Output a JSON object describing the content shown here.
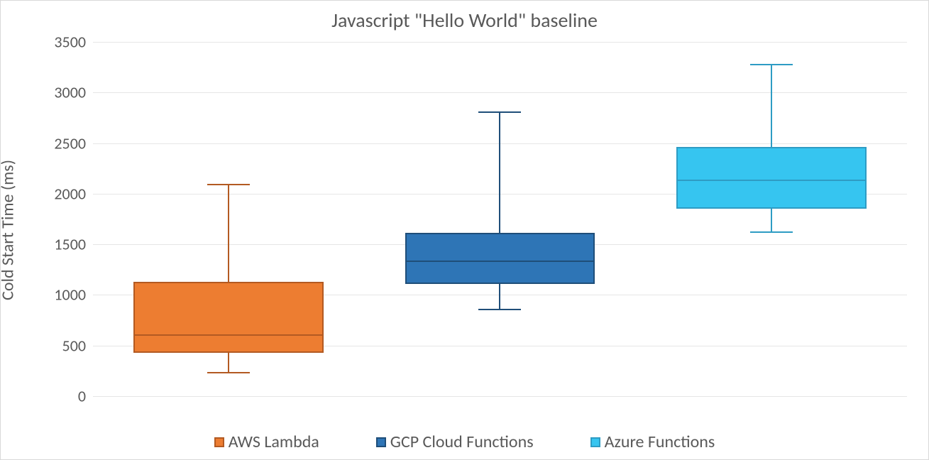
{
  "chart_data": {
    "type": "boxplot",
    "title": "Javascript \"Hello World\" baseline",
    "ylabel": "Cold Start Time (ms)",
    "xlabel": "",
    "ylim": [
      0,
      3500
    ],
    "yticks": [
      0,
      500,
      1000,
      1500,
      2000,
      2500,
      3000,
      3500
    ],
    "series": [
      {
        "name": "AWS Lambda",
        "min": 240,
        "q1": 430,
        "median": 610,
        "q3": 1130,
        "max": 2100,
        "fill": "#ED7D31",
        "border": "#B35A22"
      },
      {
        "name": "GCP Cloud Functions",
        "min": 860,
        "q1": 1110,
        "median": 1340,
        "q3": 1610,
        "max": 2810,
        "fill": "#2E75B6",
        "border": "#1F4E79"
      },
      {
        "name": "Azure Functions",
        "min": 1630,
        "q1": 1850,
        "median": 2140,
        "q3": 2460,
        "max": 3280,
        "fill": "#36C5F0",
        "border": "#2E9CC4"
      }
    ],
    "legend_position": "bottom"
  }
}
